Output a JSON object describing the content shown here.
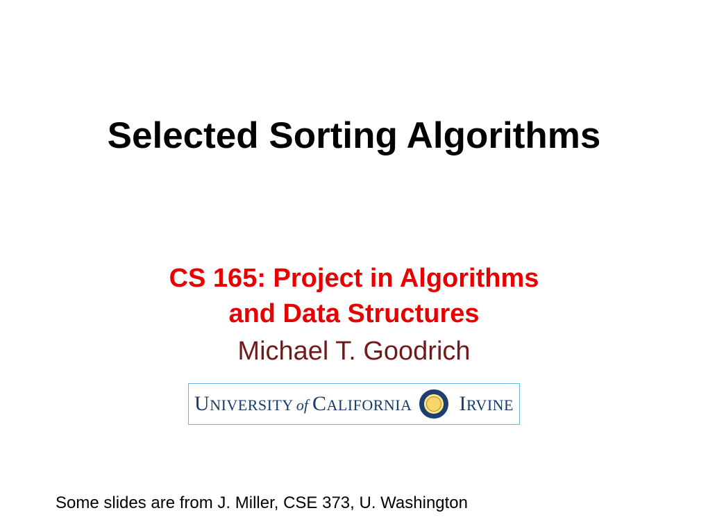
{
  "slide": {
    "title": "Selected Sorting Algorithms",
    "subtitle_line1": "CS 165: Project in Algorithms",
    "subtitle_line2": "and Data Structures",
    "author": "Michael T. Goodrich",
    "logo": {
      "university_word": "U",
      "university_sc": "NIVERSITY",
      "of": "of",
      "california_word": "C",
      "california_sc": "ALIFORNIA",
      "irvine_word": "I",
      "irvine_sc": "RVINE"
    },
    "footer_note": "Some slides are from J. Miller, CSE 373, U. Washington"
  }
}
